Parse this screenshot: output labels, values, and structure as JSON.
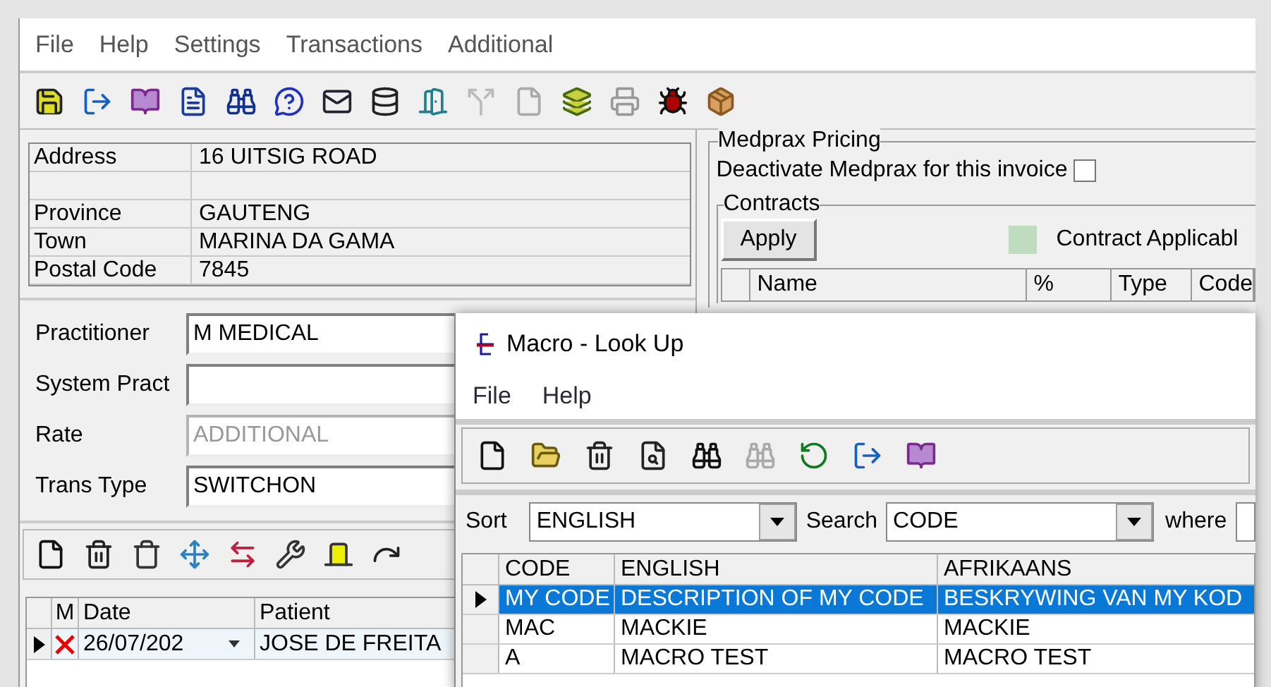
{
  "main_menu": [
    "File",
    "Help",
    "Settings",
    "Transactions",
    "Additional"
  ],
  "address": [
    {
      "kind": "field",
      "label": "Address",
      "value": "16 UITSIG ROAD"
    },
    {
      "kind": "blank"
    },
    {
      "kind": "field",
      "label": "Province",
      "value": "GAUTENG"
    },
    {
      "kind": "field",
      "label": "Town",
      "value": "MARINA DA GAMA"
    },
    {
      "kind": "field",
      "label": "Postal Code",
      "value": "7845"
    }
  ],
  "medprax": {
    "title": "Medprax Pricing",
    "deactivate": {
      "label": "Deactivate Medprax for this invoice",
      "checked": false
    }
  },
  "contracts": {
    "title": "Contracts",
    "apply_button": "Apply",
    "indicator": {
      "label": "Contract Applicabl",
      "color": "#c0dcc0"
    },
    "columns": [
      "Name",
      "%",
      "Type",
      "Code"
    ]
  },
  "practitioner_form": [
    {
      "label": "Practitioner",
      "value": "M MEDICAL",
      "disabled": false
    },
    {
      "label": "System Pract",
      "disabled": false
    },
    {
      "label": "Rate",
      "value": "ADDITIONAL",
      "disabled": true
    },
    {
      "label": "Trans Type",
      "value": "SWITCHON",
      "disabled": false
    }
  ],
  "transactions": {
    "columns": [
      "M",
      "Date",
      "Patient"
    ],
    "rows": [
      {
        "current": true,
        "marked": true,
        "date": "26/07/202",
        "patient": "JOSE DE FREITA"
      }
    ]
  },
  "macro_window": {
    "title": "Macro - Look Up",
    "menu": [
      "File",
      "Help"
    ],
    "sort": {
      "label": "Sort",
      "value": "ENGLISH"
    },
    "search": {
      "label": "Search",
      "value": "CODE"
    },
    "where": {
      "label": "where"
    },
    "table": {
      "columns": [
        "CODE",
        "ENGLISH",
        "AFRIKAANS"
      ],
      "rows": [
        {
          "selected": true,
          "cells": [
            "MY CODE",
            "DESCRIPTION OF MY CODE",
            "BESKRYWING VAN MY KOD"
          ]
        },
        {
          "selected": false,
          "cells": [
            "MAC",
            "MACKIE",
            "MACKIE"
          ]
        },
        {
          "selected": false,
          "cells": [
            "A",
            "MACRO TEST",
            "MACRO TEST"
          ]
        }
      ]
    }
  }
}
